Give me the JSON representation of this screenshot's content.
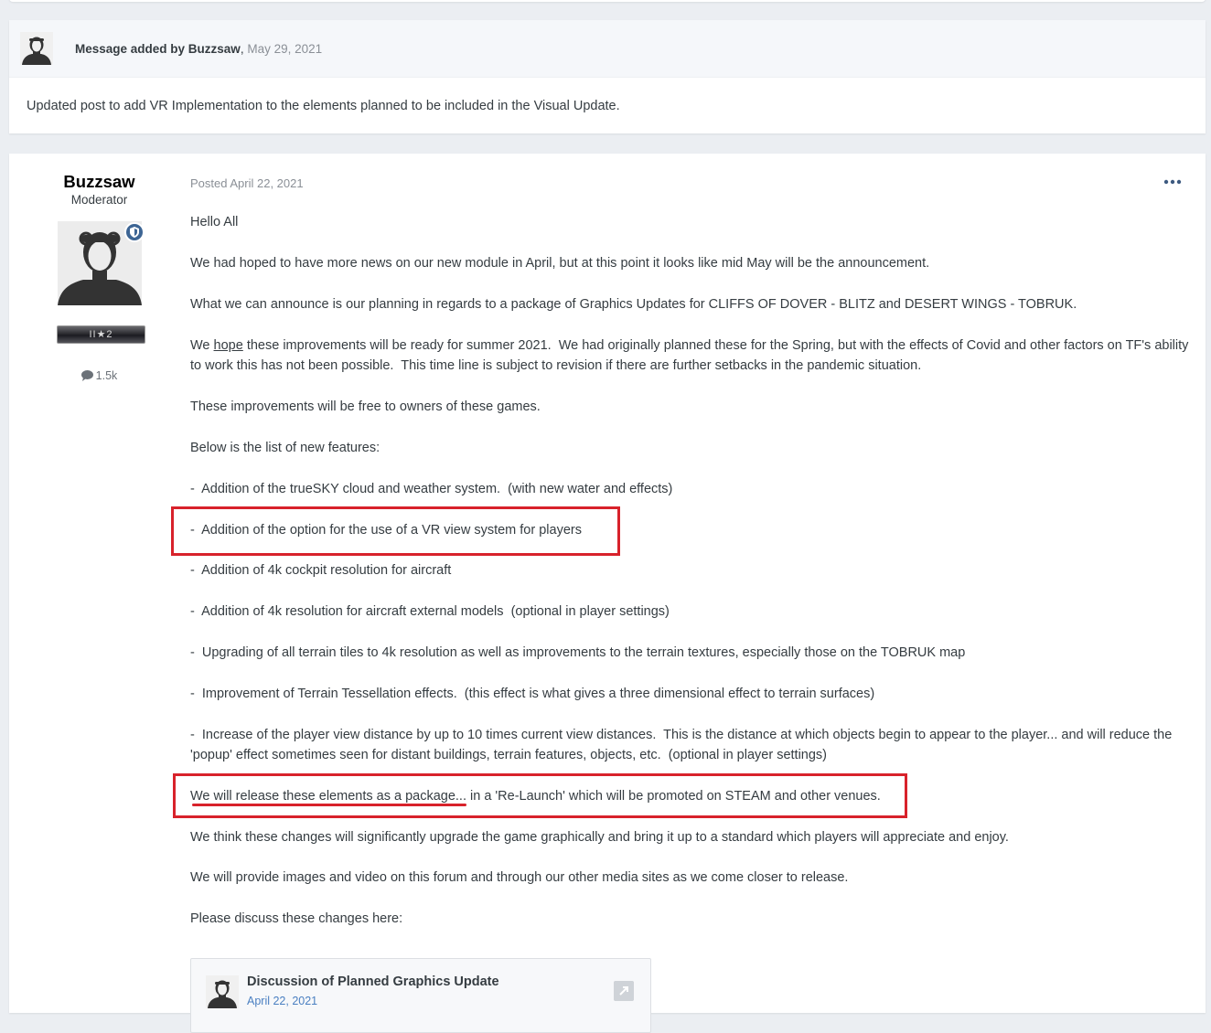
{
  "moderator_message": {
    "prefix": "Message added by ",
    "author": "Buzzsaw",
    "separator": ", ",
    "date": "May 29, 2021",
    "body": "Updated post to add VR Implementation to the elements planned to be included in the Visual Update."
  },
  "post": {
    "author": {
      "name": "Buzzsaw",
      "role": "Moderator",
      "rank_badge": "II★2",
      "reply_count": "1.5k"
    },
    "posted": "Posted April 22, 2021",
    "paragraphs": {
      "greeting": "Hello All",
      "p1": "We had hoped to have more news on our new module in April, but at this point it looks like mid May will be the announcement.",
      "p2": "What we can announce is our planning in regards to a package of Graphics Updates for CLIFFS OF DOVER - BLITZ and DESERT WINGS - TOBRUK.",
      "p3_pre": "We ",
      "p3_hope": "hope",
      "p3_post": " these improvements will be ready for summer 2021.  We had originally planned these for the Spring, but with the effects of Covid and other factors on TF's ability to work this has not been possible.  This time line is subject to revision if there are further setbacks in the pandemic situation.",
      "p4": "These improvements will be free to owners of these games.",
      "p5": "Below is the list of new features:",
      "f1": "-  Addition of the trueSKY cloud and weather system.  (with new water and effects)",
      "f2": "-  Addition of the option for the use of a VR view system for players",
      "f3": "-  Addition of 4k cockpit resolution for aircraft",
      "f4": "-  Addition of 4k resolution for aircraft external models  (optional in player settings)",
      "f5": "-  Upgrading of all terrain tiles to 4k resolution as well as improvements to the terrain textures, especially those on the TOBRUK map",
      "f6": "-  Improvement of Terrain Tessellation effects.  (this effect is what gives a three dimensional effect to terrain surfaces)",
      "f7": "-  Increase of the player view distance by up to 10 times current view distances.  This is the distance at which objects begin to appear to the player... and will reduce the 'popup' effect sometimes seen for distant buildings, terrain features, objects, etc.  (optional in player settings)",
      "release_underlined": "We will release these elements as a package",
      "release_rest": "... in a 'Re-Launch' which will be promoted on STEAM and other venues.",
      "p6": "We think these changes will significantly upgrade the game graphically and bring it up to a standard which players will appreciate and enjoy.",
      "p7": "We will provide images and video on this forum and through our other media sites as we come closer to release.",
      "p8": "Please discuss these changes here:"
    },
    "embed": {
      "title": "Discussion of Planned Graphics Update",
      "date": "April 22, 2021"
    }
  },
  "colors": {
    "annotation_red": "#d8222b",
    "background": "#ebeef2",
    "header_bg": "#f5f7fa",
    "badge_blue": "#3d6594"
  },
  "icons": [
    "pilot-avatar-icon",
    "shield-icon",
    "comment-icon",
    "more-options-icon",
    "external-link-icon"
  ]
}
